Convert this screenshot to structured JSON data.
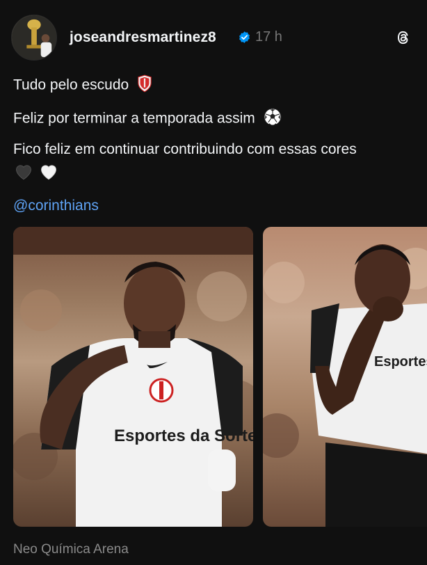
{
  "post": {
    "username": "joseandresmartinez8",
    "time": "17 h",
    "line1": "Tudo pelo escudo",
    "line2": "Feliz por terminar a temporada assim",
    "line3": "Fico feliz em continuar contribuindo com essas cores",
    "mention": "@corinthians",
    "location": "Neo Química Arena"
  },
  "icons": {
    "verified": "verified-badge-icon",
    "app": "threads-icon",
    "line1_emoji": "shield-emoji",
    "line2_emoji": "soccer-ball-emoji",
    "hearts": [
      "black-heart-emoji",
      "white-heart-emoji"
    ]
  },
  "photos": {
    "shirt_text_1": "Esportes da Sorte",
    "shirt_text_2": "Esportes da Sorte"
  },
  "colors": {
    "background": "#101010",
    "text": "#f3f5f7",
    "muted": "#777777",
    "link": "#5fa3f5",
    "verified": "#0095f6"
  }
}
